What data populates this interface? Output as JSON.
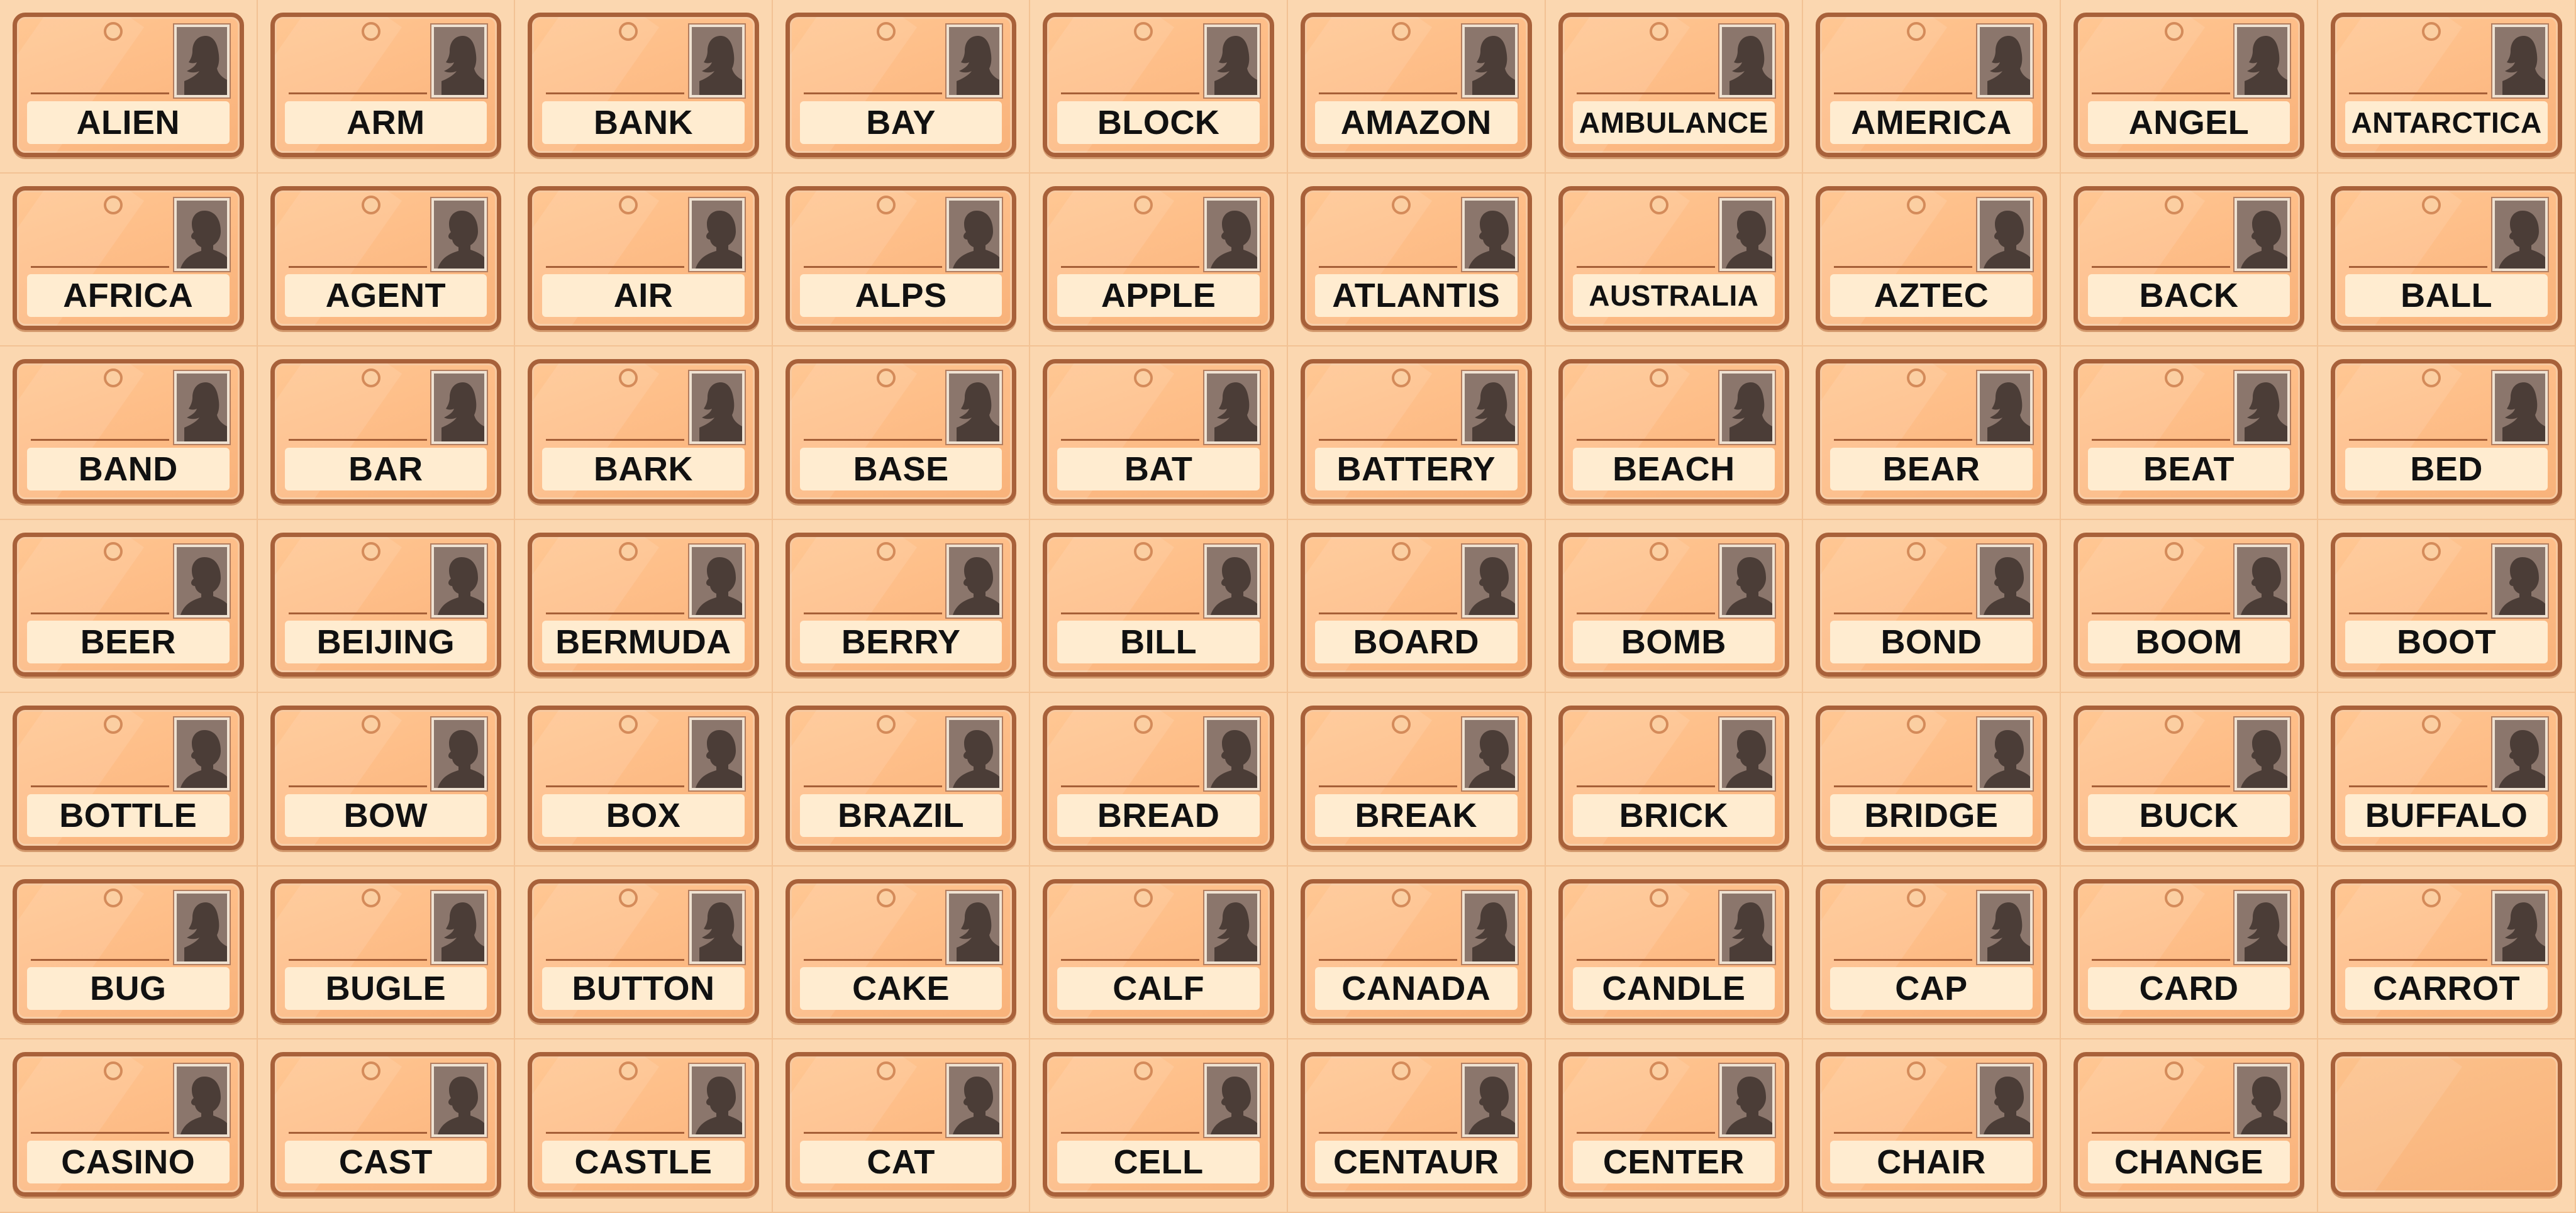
{
  "board": {
    "columns": 10,
    "rows": 7,
    "cards": [
      {
        "word": "ALIEN",
        "photo": "woman-silhouette"
      },
      {
        "word": "ARM",
        "photo": "woman-silhouette"
      },
      {
        "word": "BANK",
        "photo": "woman-silhouette"
      },
      {
        "word": "BAY",
        "photo": "woman-silhouette"
      },
      {
        "word": "BLOCK",
        "photo": "woman-silhouette"
      },
      {
        "word": "AMAZON",
        "photo": "woman-silhouette"
      },
      {
        "word": "AMBULANCE",
        "photo": "woman-silhouette"
      },
      {
        "word": "AMERICA",
        "photo": "woman-silhouette"
      },
      {
        "word": "ANGEL",
        "photo": "woman-silhouette"
      },
      {
        "word": "ANTARCTICA",
        "photo": "woman-silhouette"
      },
      {
        "word": "AFRICA",
        "photo": "man-silhouette"
      },
      {
        "word": "AGENT",
        "photo": "man-silhouette"
      },
      {
        "word": "AIR",
        "photo": "man-silhouette"
      },
      {
        "word": "ALPS",
        "photo": "man-silhouette"
      },
      {
        "word": "APPLE",
        "photo": "man-silhouette"
      },
      {
        "word": "ATLANTIS",
        "photo": "man-silhouette"
      },
      {
        "word": "AUSTRALIA",
        "photo": "man-silhouette"
      },
      {
        "word": "AZTEC",
        "photo": "man-silhouette"
      },
      {
        "word": "BACK",
        "photo": "man-silhouette"
      },
      {
        "word": "BALL",
        "photo": "man-silhouette"
      },
      {
        "word": "BAND",
        "photo": "woman-silhouette"
      },
      {
        "word": "BAR",
        "photo": "woman-silhouette"
      },
      {
        "word": "BARK",
        "photo": "woman-silhouette"
      },
      {
        "word": "BASE",
        "photo": "woman-silhouette"
      },
      {
        "word": "BAT",
        "photo": "woman-silhouette"
      },
      {
        "word": "BATTERY",
        "photo": "woman-silhouette"
      },
      {
        "word": "BEACH",
        "photo": "woman-silhouette"
      },
      {
        "word": "BEAR",
        "photo": "woman-silhouette"
      },
      {
        "word": "BEAT",
        "photo": "woman-silhouette"
      },
      {
        "word": "BED",
        "photo": "woman-silhouette"
      },
      {
        "word": "BEER",
        "photo": "man-silhouette"
      },
      {
        "word": "BEIJING",
        "photo": "man-silhouette"
      },
      {
        "word": "BERMUDA",
        "photo": "man-silhouette"
      },
      {
        "word": "BERRY",
        "photo": "man-silhouette"
      },
      {
        "word": "BILL",
        "photo": "man-silhouette"
      },
      {
        "word": "BOARD",
        "photo": "man-silhouette"
      },
      {
        "word": "BOMB",
        "photo": "man-silhouette"
      },
      {
        "word": "BOND",
        "photo": "man-silhouette"
      },
      {
        "word": "BOOM",
        "photo": "man-silhouette"
      },
      {
        "word": "BOOT",
        "photo": "man-silhouette"
      },
      {
        "word": "BOTTLE",
        "photo": "man-silhouette"
      },
      {
        "word": "BOW",
        "photo": "man-silhouette"
      },
      {
        "word": "BOX",
        "photo": "man-silhouette"
      },
      {
        "word": "BRAZIL",
        "photo": "man-silhouette"
      },
      {
        "word": "BREAD",
        "photo": "man-silhouette"
      },
      {
        "word": "BREAK",
        "photo": "man-silhouette"
      },
      {
        "word": "BRICK",
        "photo": "man-silhouette"
      },
      {
        "word": "BRIDGE",
        "photo": "man-silhouette"
      },
      {
        "word": "BUCK",
        "photo": "man-silhouette"
      },
      {
        "word": "BUFFALO",
        "photo": "man-silhouette"
      },
      {
        "word": "BUG",
        "photo": "woman-silhouette"
      },
      {
        "word": "BUGLE",
        "photo": "woman-silhouette"
      },
      {
        "word": "BUTTON",
        "photo": "woman-silhouette"
      },
      {
        "word": "CAKE",
        "photo": "woman-silhouette"
      },
      {
        "word": "CALF",
        "photo": "woman-silhouette"
      },
      {
        "word": "CANADA",
        "photo": "woman-silhouette"
      },
      {
        "word": "CANDLE",
        "photo": "woman-silhouette"
      },
      {
        "word": "CAP",
        "photo": "woman-silhouette"
      },
      {
        "word": "CARD",
        "photo": "woman-silhouette"
      },
      {
        "word": "CARROT",
        "photo": "woman-silhouette"
      },
      {
        "word": "CASINO",
        "photo": "man-silhouette"
      },
      {
        "word": "CAST",
        "photo": "man-silhouette"
      },
      {
        "word": "CASTLE",
        "photo": "man-silhouette"
      },
      {
        "word": "CAT",
        "photo": "man-silhouette"
      },
      {
        "word": "CELL",
        "photo": "man-silhouette"
      },
      {
        "word": "CENTAUR",
        "photo": "man-silhouette"
      },
      {
        "word": "CENTER",
        "photo": "man-silhouette"
      },
      {
        "word": "CHAIR",
        "photo": "man-silhouette"
      },
      {
        "word": "CHANGE",
        "photo": "man-silhouette"
      },
      {
        "word": null,
        "photo": null
      }
    ]
  },
  "colors": {
    "card_fill": "#fdbb85",
    "card_border": "#a8613a",
    "label_fill": "#ffecd0",
    "photo_bg": "#8b766c",
    "background": "#f8cfa4"
  }
}
